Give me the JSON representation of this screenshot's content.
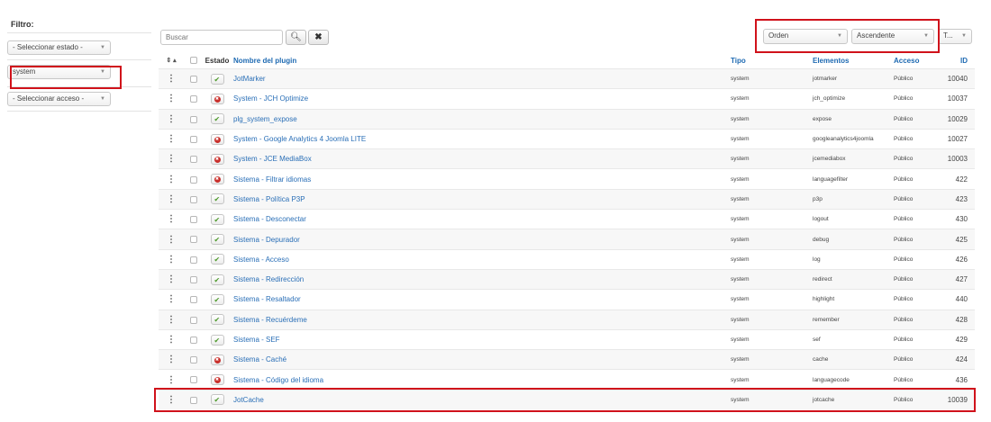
{
  "sidebar": {
    "title": "Filtro:",
    "estado_select": "- Seleccionar estado -",
    "tipo_select": "system",
    "acceso_select": "- Seleccionar acceso -"
  },
  "toolbar": {
    "search_placeholder": "Buscar",
    "search_icon": "search-icon",
    "clear_icon": "close-icon",
    "order_select": "Orden",
    "direction_select": "Ascendente",
    "limit_select": "T..."
  },
  "table": {
    "headers": {
      "sort_arrows": "⇕ ▴",
      "estado": "Estado",
      "name": "Nombre del plugin",
      "tipo": "Tipo",
      "elementos": "Elementos",
      "acceso": "Acceso",
      "id": "ID"
    },
    "rows": [
      {
        "name": "JotMarker",
        "enabled": true,
        "tipo": "system",
        "elemento": "jotmarker",
        "acceso": "Público",
        "id": "10040"
      },
      {
        "name": "System - JCH Optimize",
        "enabled": false,
        "tipo": "system",
        "elemento": "jch_optimize",
        "acceso": "Público",
        "id": "10037"
      },
      {
        "name": "plg_system_expose",
        "enabled": true,
        "tipo": "system",
        "elemento": "expose",
        "acceso": "Público",
        "id": "10029"
      },
      {
        "name": "System - Google Analytics 4 Joomla LITE",
        "enabled": false,
        "tipo": "system",
        "elemento": "googleanalytics4joomla",
        "acceso": "Público",
        "id": "10027"
      },
      {
        "name": "System - JCE MediaBox",
        "enabled": false,
        "tipo": "system",
        "elemento": "jcemediabox",
        "acceso": "Público",
        "id": "10003"
      },
      {
        "name": "Sistema - Filtrar idiomas",
        "enabled": false,
        "tipo": "system",
        "elemento": "languagefilter",
        "acceso": "Público",
        "id": "422"
      },
      {
        "name": "Sistema - Política P3P",
        "enabled": true,
        "tipo": "system",
        "elemento": "p3p",
        "acceso": "Público",
        "id": "423"
      },
      {
        "name": "Sistema - Desconectar",
        "enabled": true,
        "tipo": "system",
        "elemento": "logout",
        "acceso": "Público",
        "id": "430"
      },
      {
        "name": "Sistema - Depurador",
        "enabled": true,
        "tipo": "system",
        "elemento": "debug",
        "acceso": "Público",
        "id": "425"
      },
      {
        "name": "Sistema - Acceso",
        "enabled": true,
        "tipo": "system",
        "elemento": "log",
        "acceso": "Público",
        "id": "426"
      },
      {
        "name": "Sistema - Redirección",
        "enabled": true,
        "tipo": "system",
        "elemento": "redirect",
        "acceso": "Público",
        "id": "427"
      },
      {
        "name": "Sistema - Resaltador",
        "enabled": true,
        "tipo": "system",
        "elemento": "highlight",
        "acceso": "Público",
        "id": "440"
      },
      {
        "name": "Sistema - Recuérdeme",
        "enabled": true,
        "tipo": "system",
        "elemento": "remember",
        "acceso": "Público",
        "id": "428"
      },
      {
        "name": "Sistema - SEF",
        "enabled": true,
        "tipo": "system",
        "elemento": "sef",
        "acceso": "Público",
        "id": "429"
      },
      {
        "name": "Sistema - Caché",
        "enabled": false,
        "tipo": "system",
        "elemento": "cache",
        "acceso": "Público",
        "id": "424"
      },
      {
        "name": "Sistema - Código del idioma",
        "enabled": false,
        "tipo": "system",
        "elemento": "languagecode",
        "acceso": "Público",
        "id": "436"
      },
      {
        "name": "JotCache",
        "enabled": true,
        "tipo": "system",
        "elemento": "jotcache",
        "acceso": "Público",
        "id": "10039"
      }
    ]
  },
  "colors": {
    "highlight": "#d0121b",
    "link": "#2a6fb7",
    "enabled_check": "#4e9a2c",
    "disabled_x": "#c9302c"
  }
}
